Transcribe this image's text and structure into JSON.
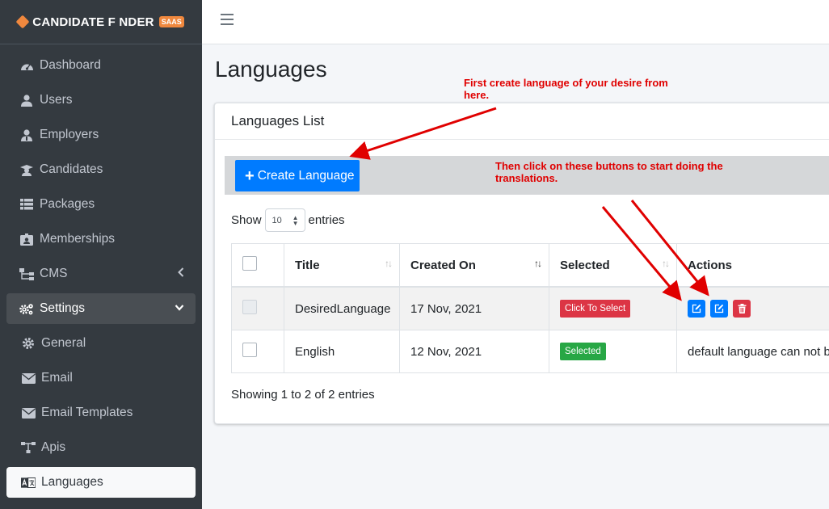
{
  "brand": {
    "text": "CANDIDATE F NDER",
    "badge": "SAAS"
  },
  "sidebar": {
    "items": [
      {
        "label": "Dashboard",
        "icon": "dashboard-icon"
      },
      {
        "label": "Users",
        "icon": "user-icon"
      },
      {
        "label": "Employers",
        "icon": "employer-icon"
      },
      {
        "label": "Candidates",
        "icon": "graduate-icon"
      },
      {
        "label": "Packages",
        "icon": "list-icon"
      },
      {
        "label": "Memberships",
        "icon": "id-badge-icon"
      },
      {
        "label": "CMS",
        "icon": "sitemap-icon"
      },
      {
        "label": "Settings",
        "icon": "cogs-icon"
      },
      {
        "label": "General",
        "icon": "gear-icon"
      },
      {
        "label": "Email",
        "icon": "envelope-icon"
      },
      {
        "label": "Email Templates",
        "icon": "envelope-icon"
      },
      {
        "label": "Apis",
        "icon": "network-icon"
      },
      {
        "label": "Languages",
        "icon": "language-icon"
      }
    ]
  },
  "page": {
    "title": "Languages"
  },
  "card": {
    "header": "Languages List"
  },
  "toolbar": {
    "create_label": "Create Language"
  },
  "length": {
    "show": "Show",
    "value": "10",
    "entries": "entries"
  },
  "table": {
    "headers": [
      "Title",
      "Created On",
      "Selected",
      "Actions"
    ],
    "rows": [
      {
        "title": "DesiredLanguage",
        "created": "17 Nov, 2021",
        "selected": "Click To Select",
        "actions": ""
      },
      {
        "title": "English",
        "created": "12 Nov, 2021",
        "selected": "Selected",
        "actions": "default language can not be"
      }
    ]
  },
  "info": "Showing 1 to 2 of 2 entries",
  "annotations": {
    "first": "First create language of your desire from here.",
    "second": "Then click on these buttons to start doing the translations."
  },
  "colors": {
    "sidebar": "#343a40",
    "primary": "#007bff",
    "danger": "#dc3545",
    "success": "#28a745",
    "annotation": "#e00000"
  }
}
